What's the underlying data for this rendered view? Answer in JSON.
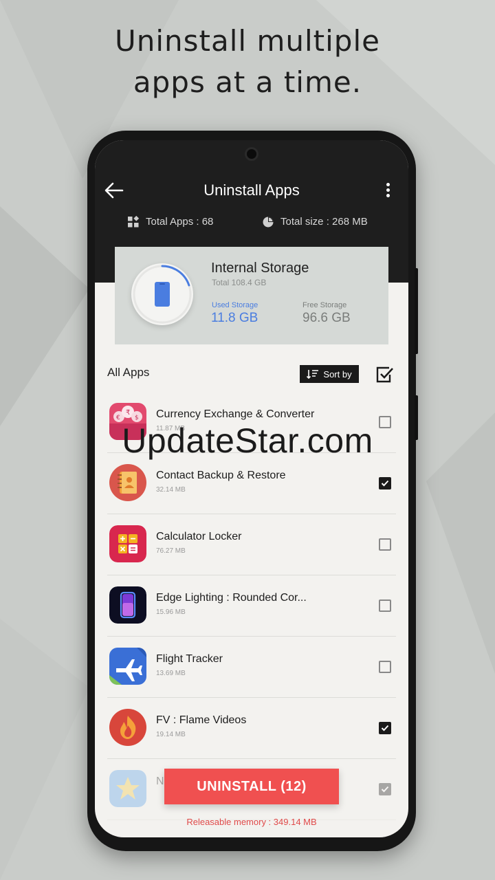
{
  "headline": {
    "line1": "Uninstall multiple",
    "line2": "apps at a time."
  },
  "header": {
    "title": "Uninstall Apps",
    "total_apps": "Total Apps : 68",
    "total_size": "Total size : 268 MB"
  },
  "storage": {
    "title": "Internal Storage",
    "total": "Total 108.4 GB",
    "used_label": "Used Storage",
    "used_value": "11.8 GB",
    "free_label": "Free Storage",
    "free_value": "96.6 GB",
    "used_fraction": 0.11
  },
  "list_header": {
    "title": "All Apps",
    "sort_label": "Sort by"
  },
  "apps": [
    {
      "name": "Currency Exchange & Converter",
      "size": "11.87 MB",
      "checked": false,
      "icon": "currency-icon"
    },
    {
      "name": "Contact Backup & Restore",
      "size": "32.14 MB",
      "checked": true,
      "icon": "contact-book-icon"
    },
    {
      "name": "Calculator Locker",
      "size": "76.27 MB",
      "checked": false,
      "icon": "calculator-icon"
    },
    {
      "name": "Edge Lighting : Rounded Cor...",
      "size": "15.96 MB",
      "checked": false,
      "icon": "edge-lighting-icon"
    },
    {
      "name": "Flight Tracker",
      "size": "13.69 MB",
      "checked": false,
      "icon": "airplane-icon"
    },
    {
      "name": "FV : Flame Videos",
      "size": "19.14 MB",
      "checked": true,
      "icon": "flame-icon"
    },
    {
      "name": "N",
      "size": "",
      "checked": true,
      "icon": "app-icon"
    }
  ],
  "footer": {
    "uninstall_label": "UNINSTALL (12)",
    "releasable": "Releasable memory : 349.14 MB"
  },
  "watermark": "UpdateStar.com",
  "colors": {
    "accent_red": "#f05050",
    "used_blue": "#4a7de0",
    "header_dark": "#1e1e1e"
  }
}
